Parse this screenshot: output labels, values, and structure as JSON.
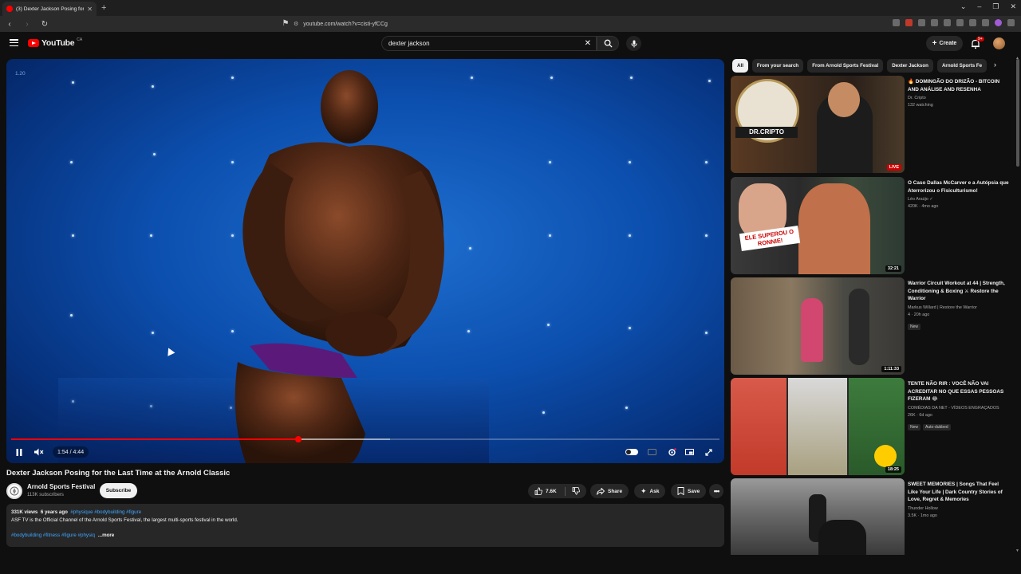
{
  "browser": {
    "tab_title": "(3) Dexter Jackson Posing for the",
    "url": "youtube.com/watch?v=cisti-yfCCg"
  },
  "header": {
    "logo_text": "YouTube",
    "logo_region": "CA",
    "search_value": "dexter jackson",
    "create_label": "Create",
    "notification_count": "9+"
  },
  "player": {
    "speed_label": "1.20",
    "current_time": "1:54",
    "duration": "4:44",
    "time_display": "1:54 / 4:44",
    "played_fraction": 0.405,
    "buffered_fraction": 0.535,
    "state": "playing",
    "muted": true
  },
  "video": {
    "title": "Dexter Jackson Posing for the Last Time at the Arnold Classic",
    "channel": "Arnold Sports Festival",
    "subscribers": "113K subscribers",
    "subscribe_label": "Subscribe",
    "likes": "7.6K",
    "share_label": "Share",
    "ask_label": "Ask",
    "save_label": "Save",
    "description": {
      "views": "331K views",
      "age": "6 years ago",
      "meta_tags": "#physique #bodybuilding #figure",
      "line": "ASF TV is the Official Channel of the Arnold Sports Festival, the largest multi-sports festival in the world.",
      "tags": "#bodybuilding #fitness #figure #physiq",
      "more": "...more"
    }
  },
  "sidebar": {
    "chips": [
      "All",
      "From your search",
      "From Arnold Sports Festival",
      "Dexter Jackson",
      "Arnold Sports Fe"
    ],
    "recommendations": [
      {
        "title": "🔥 DOMINGÃO DO DRIZÃO - BITCOIN AND ANÁLISE AND RESENHA",
        "channel": "Dr. Cripto",
        "meta": "132 watching",
        "badge": "LIVE",
        "thumb_text": "DR.CRIPTO"
      },
      {
        "title": "O Caso Dallas McCarver e a Autópsia que Aterrorizou o Fisiculturismo!",
        "channel": "Léo Araújo ✓",
        "meta": "420K · 4mo ago",
        "duration": "32:21",
        "thumb_text": "ELE SUPEROU O RONNIE!"
      },
      {
        "title": "Warrior Circuit Workout at 44 | Strength, Conditioning & Boxing ⚔ Restore the Warrior",
        "channel": "Markus Willard | Restore the Warrior",
        "meta": "4 · 20h ago",
        "tag": "New",
        "duration": "1:11:33"
      },
      {
        "title": "TENTE NÃO RIR : VOCÊ NÃO VAI ACREDITAR NO QUE ESSAS PESSOAS FIZERAM 😂",
        "channel": "COMÉDIAS DA NET - VÍDEOS ENGRAÇADOS",
        "meta": "26K · 6d ago",
        "tag": "New",
        "tag2": "Auto-dubbed",
        "duration": "18:25"
      },
      {
        "title": "SWEET MEMORIES | Songs That Feel Like Your Life | Dark Country Stories of Love, Regret & Memories",
        "channel": "Thunder Hollow",
        "meta": "3.5K · 1mo ago"
      }
    ]
  },
  "colors": {
    "accent_red": "#ff0000",
    "bg": "#0f0f0f",
    "surface": "#272727",
    "link_blue": "#3ea6ff"
  }
}
